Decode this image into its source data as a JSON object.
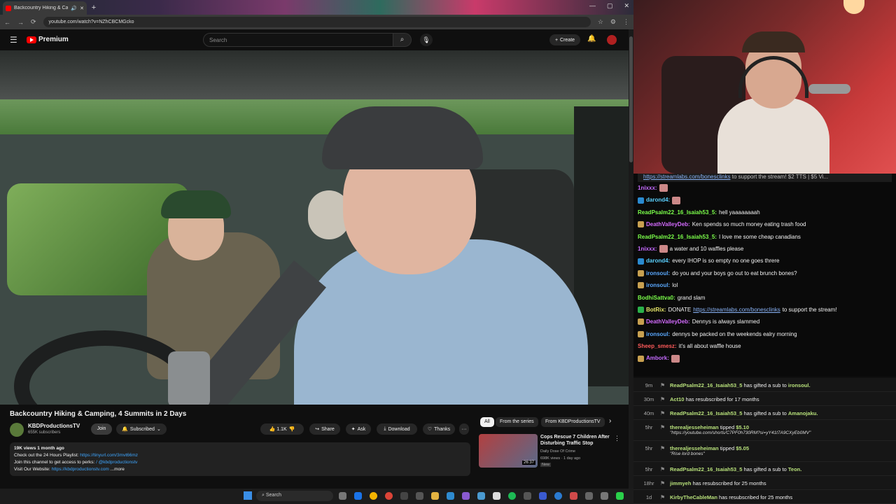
{
  "browser": {
    "tab_title": "Backcountry Hiking & Camp",
    "url": "youtube.com/watch?v=NZhCBCMGcko",
    "new_tab": "+",
    "win_controls": [
      "—",
      "▢",
      "✕"
    ]
  },
  "header": {
    "logo_text": "Premium",
    "search_placeholder": "Search",
    "create_label": "Create"
  },
  "video": {
    "title": "Backcountry Hiking & Camping, 4 Summits in 2 Days",
    "channel": "KBDProductionsTV",
    "subscribers": "655K subscribers",
    "join_label": "Join",
    "subscribed_label": "Subscribed",
    "likes": "1.1K",
    "share_label": "Share",
    "ask_label": "Ask",
    "download_label": "Download",
    "thanks_label": "Thanks",
    "more_actions": "···"
  },
  "description": {
    "meta": "19K views  1 month ago",
    "line1_prefix": "Check out the 24 Hours Playlist: ",
    "line1_link": "https://tinyurl.com/3mvt66mz",
    "line2_prefix": "Join this channel to get access to perks: ",
    "line2_link": "/ @kbdproductionstv",
    "line3_prefix": "Visit Our Website: ",
    "line3_link": "https://kbdproductionstv.com",
    "more": "...more"
  },
  "related": {
    "chips": [
      "All",
      "From the series",
      "From KBDProductionsTV"
    ],
    "next_icon": "›",
    "item": {
      "title": "Cops Rescue 7 Children After Disturbing Traffic Stop",
      "channel": "Daily Dose Of Crime",
      "views": "698K views · 1 day ago",
      "badge": "New",
      "duration": "26:37"
    }
  },
  "chat": {
    "banner_link": "https://streamlabs.com/bonesclinks",
    "banner_rest": " to support the stream! $2 TTS | $5 Vi...",
    "messages": [
      {
        "user": "1nixxx:",
        "color": "#c66bff",
        "text": "",
        "emote": true,
        "badge": ""
      },
      {
        "user": "darond4:",
        "color": "#5ad0ff",
        "text": "",
        "emote": true,
        "badge": "#2a8ad0"
      },
      {
        "user": "ReadPsalm22_16_Isaiah53_5:",
        "color": "#7bff4a",
        "text": "hell yaaaaaaaah",
        "emote": false,
        "badge": ""
      },
      {
        "user": "DeathValleyDeb:",
        "color": "#d46bff",
        "text": "Ken spends so much money eating trash food",
        "emote": false,
        "badge": "#c8a050"
      },
      {
        "user": "ReadPsalm22_16_Isaiah53_5:",
        "color": "#7bff4a",
        "text": "I love me some cheap canadians",
        "emote": false,
        "badge": ""
      },
      {
        "user": "1nixxx:",
        "color": "#c66bff",
        "text": "a water and 10 waffles please",
        "emote": true,
        "badge": ""
      },
      {
        "user": "darond4:",
        "color": "#5ad0ff",
        "text": "every IHOP is so empty no one goes threre",
        "emote": false,
        "badge": "#2a8ad0"
      },
      {
        "user": "ironsoul:",
        "color": "#5aa8ff",
        "text": "do you and your boys go out to eat brunch bones?",
        "emote": false,
        "badge": "#c8a050"
      },
      {
        "user": "ironsoul:",
        "color": "#5aa8ff",
        "text": "lol",
        "emote": false,
        "badge": "#c8a050"
      },
      {
        "user": "BodhiSattva0:",
        "color": "#7bff4a",
        "text": "grand slam",
        "emote": false,
        "badge": ""
      },
      {
        "user": "BotRix:",
        "color": "#e8e86a",
        "text": "DONATE ",
        "link": "https://streamlabs.com/bonesclinks",
        "text2": " to support the stream!",
        "emote": false,
        "badge": "#2ab04a"
      },
      {
        "user": "DeathValleyDeb:",
        "color": "#d46bff",
        "text": "Dennys is always slammed",
        "emote": false,
        "badge": "#c8a050"
      },
      {
        "user": "ironsoul:",
        "color": "#5aa8ff",
        "text": "dennys be packed on the weekends ealry morning",
        "emote": false,
        "badge": "#c8a050"
      },
      {
        "user": "Sheep_smesz:",
        "color": "#ff5a5a",
        "text": "it's all about waffle house",
        "emote": false,
        "badge": ""
      },
      {
        "user": "Ambork:",
        "color": "#c66bff",
        "text": "",
        "emote": true,
        "badge": "#c8a050"
      }
    ]
  },
  "events": [
    {
      "time": "9m",
      "name": "ReadPsalm22_16_Isaiah53_5",
      "text": " has gifted a sub to ",
      "target": "ironsoul."
    },
    {
      "time": "30m",
      "name": "Act10",
      "text": " has resubscribed for 17 months",
      "target": ""
    },
    {
      "time": "40m",
      "name": "ReadPsalm22_16_Isaiah53_5",
      "text": " has gifted a sub to ",
      "target": "Amanojaku."
    },
    {
      "time": "5hr",
      "name": "therealjesseheiman",
      "text": " tipped ",
      "target": "$5.10",
      "sub": "\"https://youtube.com/shorts/C7PF0h730RM?si=yY41t7A9CXyEb0MV\""
    },
    {
      "time": "5hr",
      "name": "therealjesseheiman",
      "text": " tipped ",
      "target": "$5.05",
      "sub": "\"Rise lord bones\""
    },
    {
      "time": "5hr",
      "name": "ReadPsalm22_16_Isaiah53_5",
      "text": " has gifted a sub to ",
      "target": "Teon."
    },
    {
      "time": "18hr",
      "name": "jimmyeh",
      "text": " has resubscribed for 25 months",
      "target": ""
    },
    {
      "time": "1d",
      "name": "KirbyTheCableMan",
      "text": " has resubscribed for 25 months",
      "target": ""
    }
  ],
  "taskbar": {
    "search_label": "Search"
  }
}
